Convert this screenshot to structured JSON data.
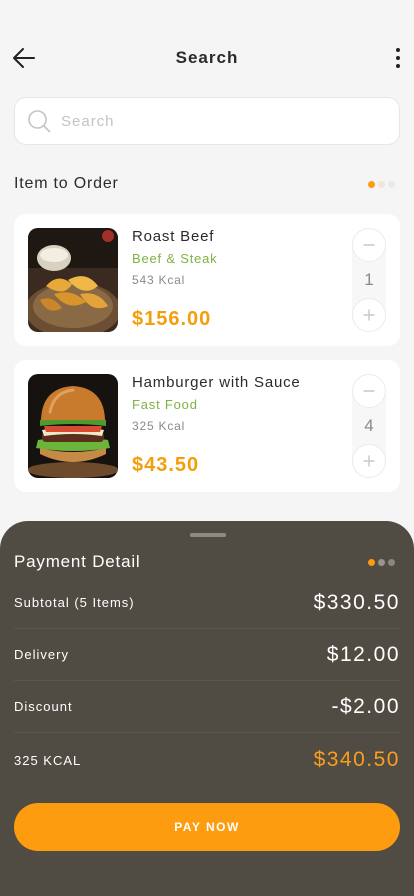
{
  "header": {
    "title": "Search"
  },
  "search": {
    "placeholder": "Search",
    "value": ""
  },
  "order_section": {
    "title": "Item to Order"
  },
  "items": [
    {
      "name": "Roast Beef",
      "category": "Beef & Steak",
      "kcal": "543 Kcal",
      "price": "$156.00",
      "quantity": "1",
      "image": "roast-beef-photo"
    },
    {
      "name": "Hamburger with Sauce",
      "category": "Fast Food",
      "kcal": "325 Kcal",
      "price": "$43.50",
      "quantity": "4",
      "image": "hamburger-photo"
    }
  ],
  "payment": {
    "title": "Payment Detail",
    "rows": [
      {
        "label": "Subtotal (5 Items)",
        "value": "$330.50"
      },
      {
        "label": "Delivery",
        "value": "$12.00"
      },
      {
        "label": "Discount",
        "value": "-$2.00"
      },
      {
        "label": "325 KCAL",
        "value": "$340.50"
      }
    ],
    "button": "PAY NOW"
  },
  "colors": {
    "accent": "#fd9c0f",
    "category_green": "#7cb342",
    "sheet_bg": "#504c43",
    "page_bg": "#f5f5f5"
  },
  "icons": {
    "back": "arrow-left-icon",
    "menu": "more-vertical-icon",
    "search": "search-icon",
    "minus": "minus-icon",
    "plus": "plus-icon"
  }
}
